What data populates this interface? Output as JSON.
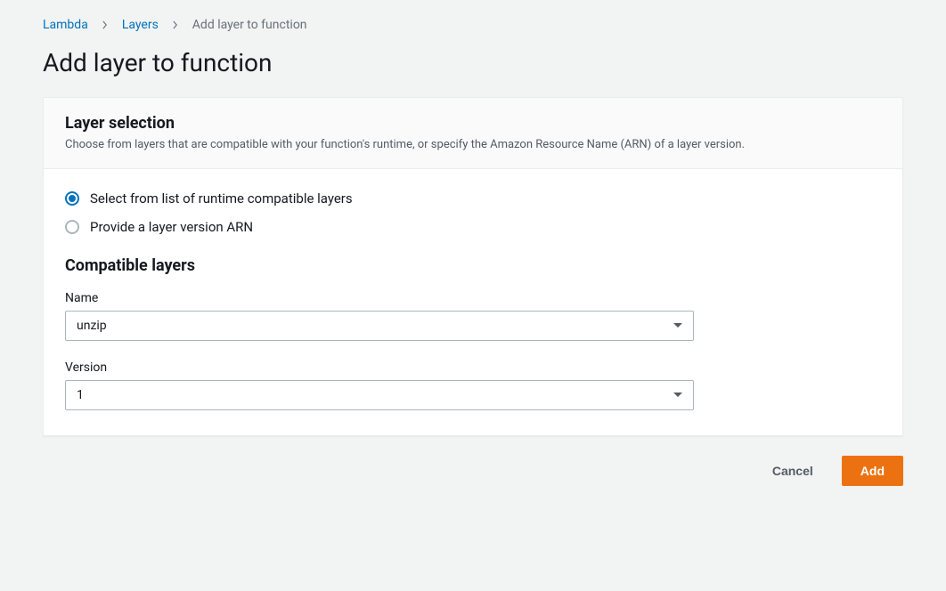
{
  "breadcrumb": {
    "items": [
      {
        "label": "Lambda"
      },
      {
        "label": "Layers"
      }
    ],
    "current": "Add layer to function"
  },
  "page_title": "Add layer to function",
  "panel": {
    "title": "Layer selection",
    "description": "Choose from layers that are compatible with your function's runtime, or specify the Amazon Resource Name (ARN) of a layer version."
  },
  "radio": {
    "option_compatible": "Select from list of runtime compatible layers",
    "option_arn": "Provide a layer version ARN"
  },
  "section_title": "Compatible layers",
  "fields": {
    "name": {
      "label": "Name",
      "value": "unzip"
    },
    "version": {
      "label": "Version",
      "value": "1"
    }
  },
  "actions": {
    "cancel": "Cancel",
    "add": "Add"
  }
}
